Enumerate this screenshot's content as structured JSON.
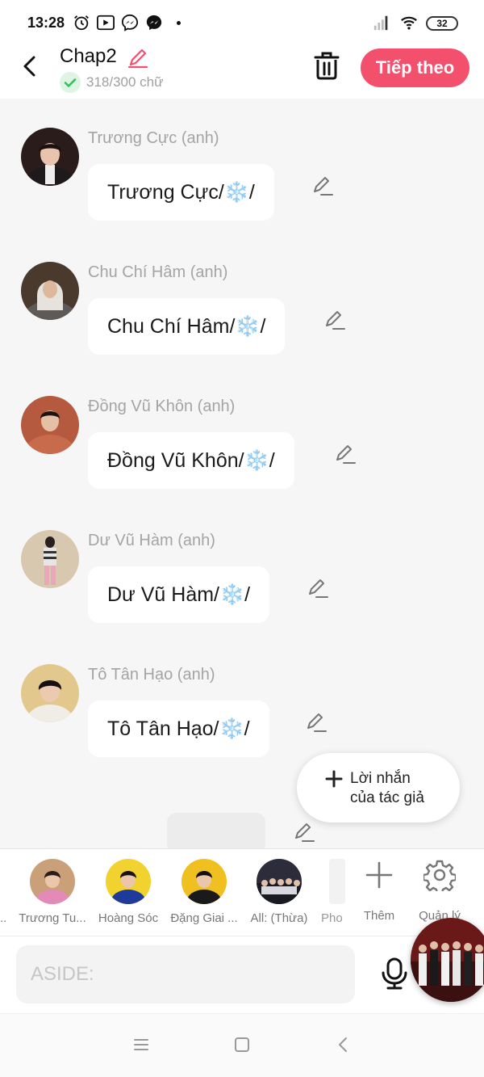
{
  "status_bar": {
    "time": "13:28",
    "battery": "32",
    "icons": [
      "alarm-icon",
      "youtube-icon",
      "messenger-icon",
      "messenger-icon",
      "signal-icon",
      "wifi-icon",
      "battery-icon"
    ]
  },
  "header": {
    "title": "Chap2",
    "word_count": "318/300 chữ",
    "next_label": "Tiếp theo",
    "accent_color": "#f2506c"
  },
  "messages": [
    {
      "name": "Trương Cực (anh)",
      "text": "Trương Cực/❄️/"
    },
    {
      "name": "Chu Chí Hâm (anh)",
      "text": "Chu Chí Hâm/❄️/"
    },
    {
      "name": "Đồng Vũ Khôn (anh)",
      "text": "Đồng Vũ Khôn/❄️/"
    },
    {
      "name": "Dư Vũ Hàm (anh)",
      "text": "Dư Vũ Hàm/❄️/"
    },
    {
      "name": "Tô Tân Hạo (anh)",
      "text": "Tô Tân Hạo/❄️/"
    }
  ],
  "author_note": {
    "line1": "Lời nhắn",
    "line2": "của tác giả"
  },
  "characters": {
    "leading_ellipsis": "..",
    "items": [
      {
        "label": "Trương Tu..."
      },
      {
        "label": "Hoàng Sóc"
      },
      {
        "label": "Đặng Giai ..."
      },
      {
        "label": "All: (Thừa)"
      },
      {
        "label": "Pho"
      }
    ],
    "add_label": "Thêm",
    "manage_label": "Quản lý"
  },
  "input": {
    "placeholder": "ASIDE:"
  }
}
